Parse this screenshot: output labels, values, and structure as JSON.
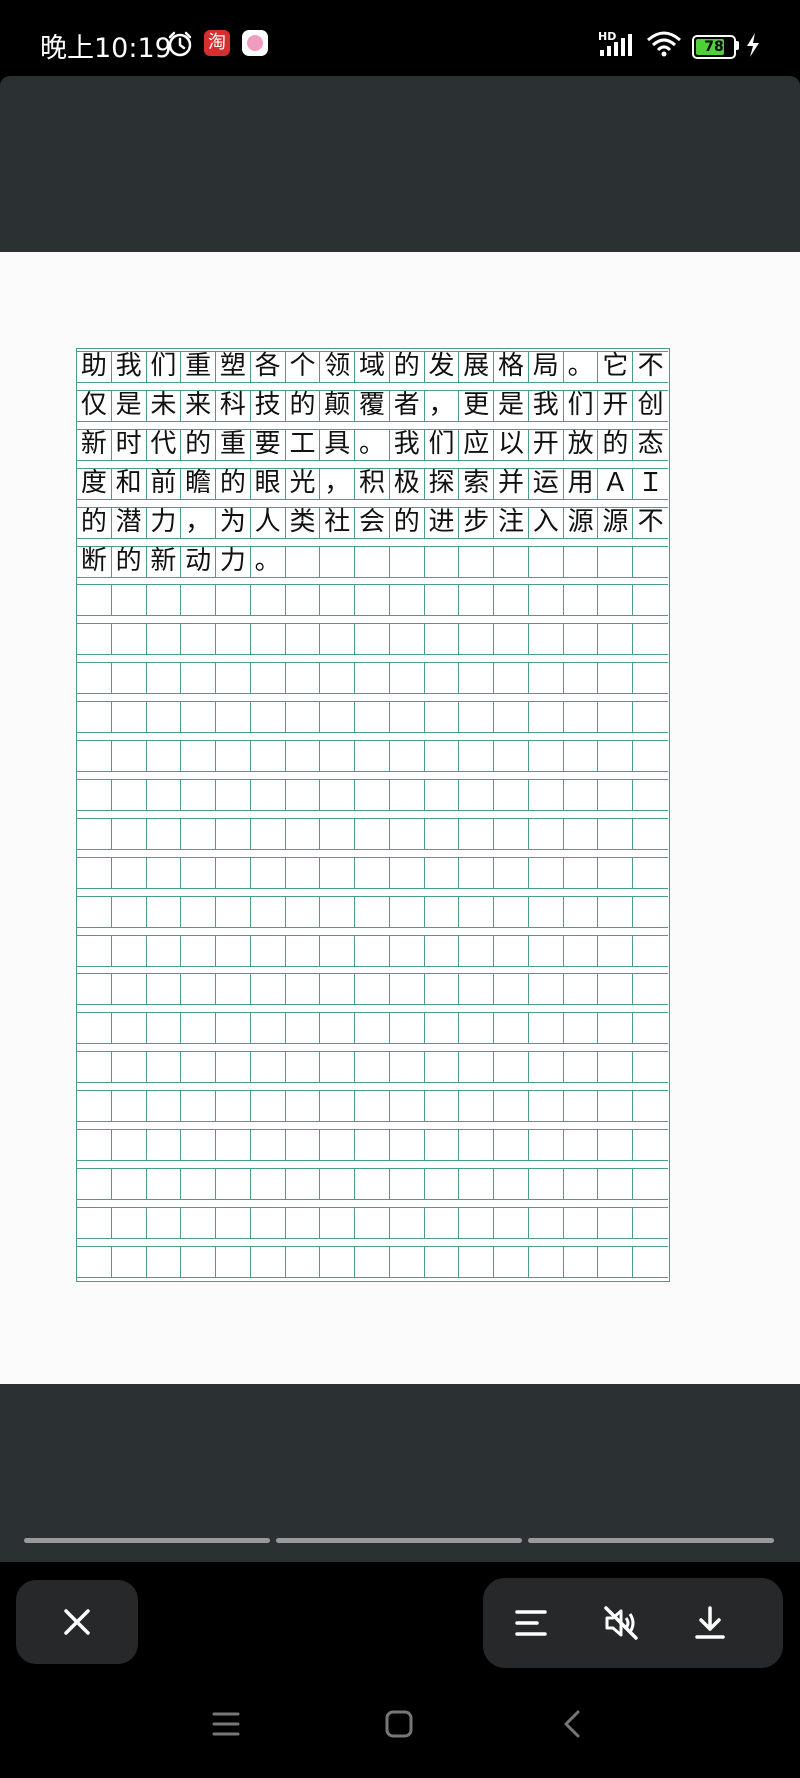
{
  "status_bar": {
    "time": "晚上10:19",
    "taobao_label": "淘",
    "network_label": "HD",
    "battery_level": 78,
    "icons": [
      "alarm-icon",
      "taobao-app-icon",
      "app-icon",
      "signal-icon",
      "wifi-icon",
      "battery-icon",
      "charging-icon"
    ]
  },
  "document": {
    "lines": [
      "助我们重塑各个领域的发展格局。它不",
      "仅是未来科技的颠覆者，更是我们开创",
      "新时代的重要工具。我们应以开放的态",
      "度和前瞻的眼光，积极探索并运用ＡＩ",
      "的潜力，为人类社会的进步注入源源不",
      "断的新动力。"
    ],
    "rows_total": 24,
    "columns": 17,
    "grid_color": "#4a9d86"
  },
  "viewer": {
    "progress_segments": 3
  },
  "controls": {
    "close_icon": "close-icon",
    "menu_icon": "menu-icon",
    "mute_icon": "mute-icon",
    "download_icon": "download-icon"
  },
  "nav_bar": {
    "icons": [
      "nav-menu-icon",
      "nav-home-icon",
      "nav-back-icon"
    ]
  }
}
